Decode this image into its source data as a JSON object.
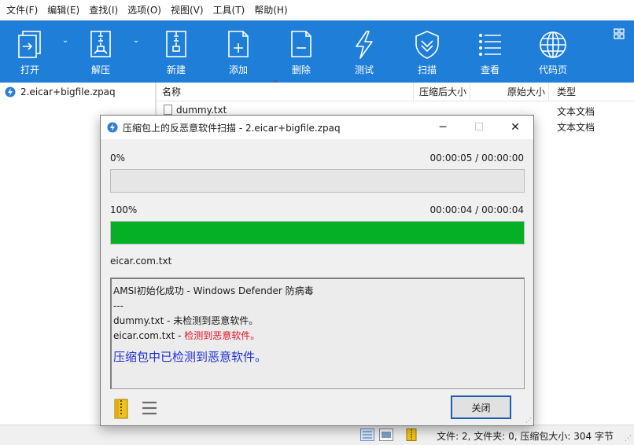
{
  "menu": [
    "文件(F)",
    "编辑(E)",
    "查找(I)",
    "选项(O)",
    "视图(V)",
    "工具(T)",
    "帮助(H)"
  ],
  "toolbar": {
    "open": "打开",
    "extract": "解压",
    "new": "新建",
    "add": "添加",
    "delete": "删除",
    "test": "测试",
    "scan": "扫描",
    "view": "查看",
    "codepage": "代码页",
    "icons": {
      "open": "open-archive-icon",
      "extract": "extract-zip-icon",
      "new": "new-archive-icon",
      "add": "add-file-icon",
      "delete": "delete-file-icon",
      "test": "lightning-icon",
      "scan": "shield-icon",
      "view": "list-icon",
      "codepage": "globe-icon"
    }
  },
  "tree": {
    "item": "2.eicar+bigfile.zpaq"
  },
  "columns": {
    "name": "名称",
    "compressed": "压缩后大小",
    "original": "原始大小",
    "type": "类型"
  },
  "files": [
    {
      "name": "dummy.txt",
      "type": "文本文档"
    },
    {
      "name": "",
      "type": "文本文档"
    }
  ],
  "status": {
    "text": "文件: 2, 文件夹: 0, 压缩包大小: 304 字节"
  },
  "dialog": {
    "title": "压缩包上的反恶意软件扫描 - 2.eicar+bigfile.zpaq",
    "overall_percent_label": "0%",
    "overall_time": "00:00:05 / 00:00:00",
    "overall_progress": 0,
    "file_percent_label": "100%",
    "file_time": "00:00:04 / 00:00:04",
    "file_progress": 1.0,
    "current_file": "eicar.com.txt",
    "log": {
      "amsi": "AMSI初始化成功 - Windows Defender 防病毒",
      "separator": "---",
      "dummy": "dummy.txt - 未检测到恶意软件。",
      "eicar_name": "eicar.com.txt - ",
      "eicar_result": "检测到恶意软件。",
      "summary": "压缩包中已检测到恶意软件。"
    },
    "close_label": "关闭"
  },
  "colors": {
    "toolbar_bg": "#1f7ed8",
    "progress_fill": "#06b025",
    "malware_red": "#e81123",
    "summary_blue": "#1d2fd1"
  }
}
